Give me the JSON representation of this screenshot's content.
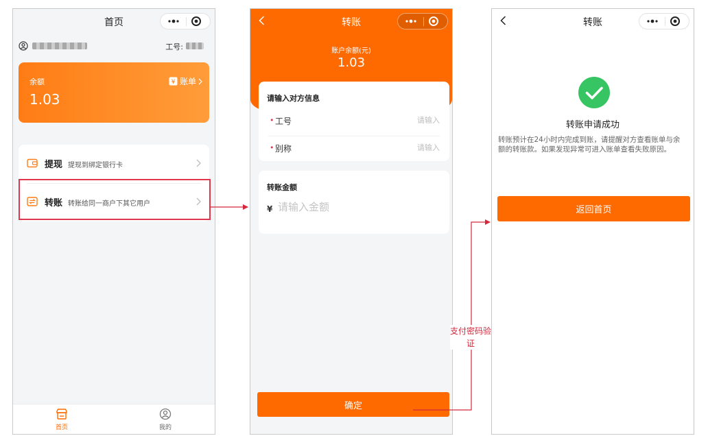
{
  "colors": {
    "accent": "#ff6a00",
    "annotation": "#d4283d",
    "success": "#37c462"
  },
  "home": {
    "title": "首页",
    "job_label": "工号:",
    "balance_label": "余额",
    "balance_value": "1.03",
    "bill_label": "账单",
    "menu": [
      {
        "title": "提现",
        "desc": "提现到绑定银行卡",
        "icon": "wallet-icon"
      },
      {
        "title": "转账",
        "desc": "转账给同一商户下其它用户",
        "icon": "transfer-icon"
      }
    ],
    "tabs": [
      {
        "label": "首页",
        "icon": "store-icon",
        "active": true
      },
      {
        "label": "我的",
        "icon": "profile-icon",
        "active": false
      }
    ]
  },
  "transfer": {
    "title": "转账",
    "account_balance_label": "账户余额(元)",
    "account_balance_value": "1.03",
    "info_heading": "请输入对方信息",
    "fields": [
      {
        "label": "工号",
        "placeholder": "请输入"
      },
      {
        "label": "别称",
        "placeholder": "请输入"
      }
    ],
    "amount_heading": "转账金额",
    "currency": "¥",
    "amount_placeholder": "请输入金额",
    "confirm_label": "确定"
  },
  "result": {
    "title": "转账",
    "success_title": "转账申请成功",
    "success_desc": "转账预计在24小时内完成到账，请提醒对方查看账单与余额的转账款。如果发现异常可进入账单查看失败原因。",
    "return_label": "返回首页"
  },
  "flow_note": "支付密码验证"
}
